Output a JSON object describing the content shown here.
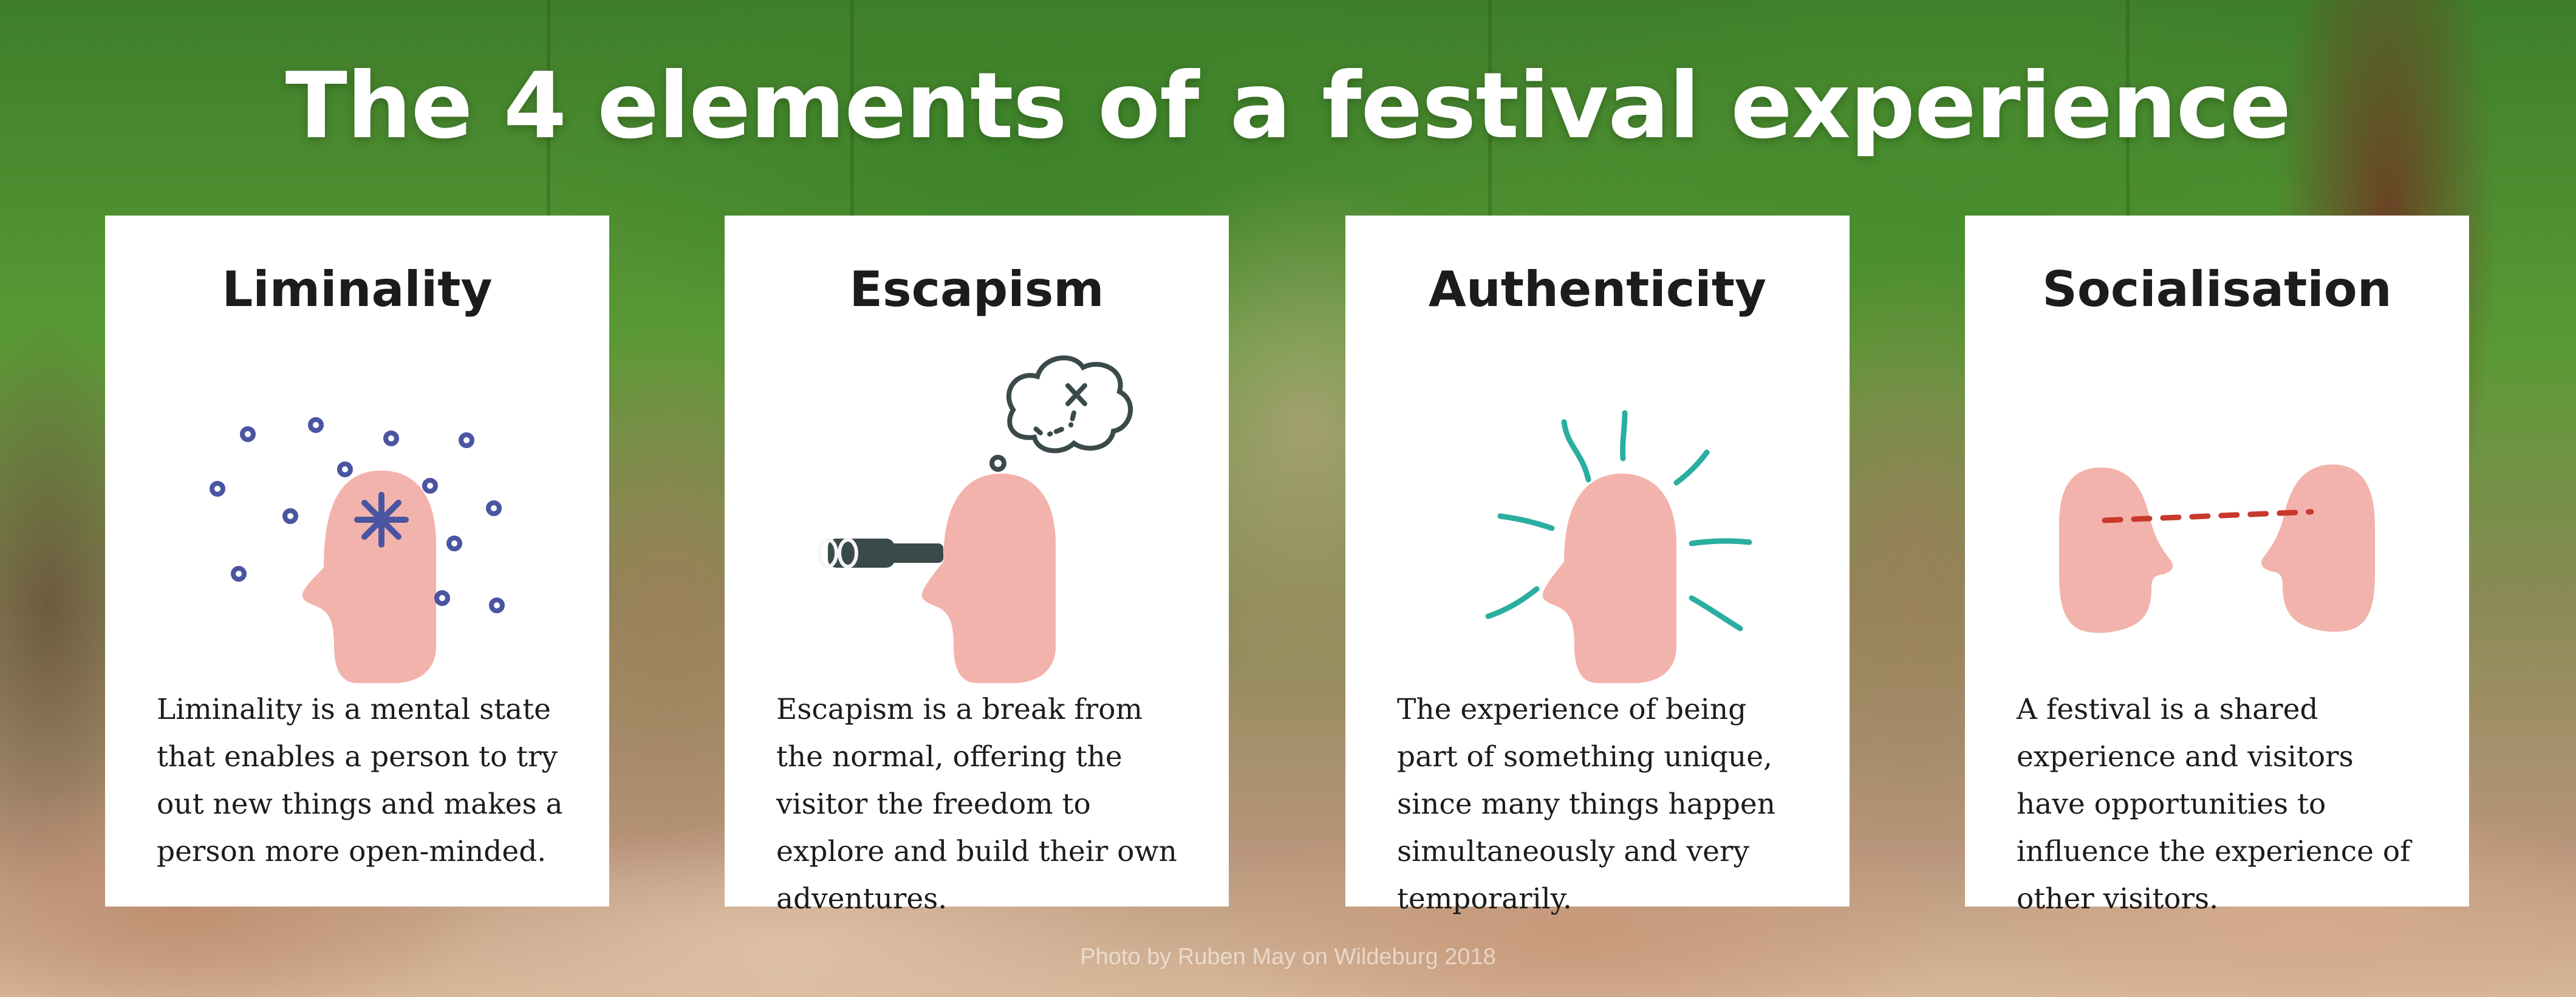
{
  "title": "The 4 elements of a festival experience",
  "cards": [
    {
      "heading": "Liminality",
      "icon": "head-with-asterisk-and-dots-icon",
      "text": "Liminality is a mental state that enables a person to try out new things and makes a person more open-minded."
    },
    {
      "heading": "Escapism",
      "icon": "head-with-binoculars-and-treasure-map-thought-icon",
      "text": "Escapism is a break from the normal, offering the visitor the freedom to explore and build their own adventures."
    },
    {
      "heading": "Authenticity",
      "icon": "head-with-radiating-lines-icon",
      "text": "The experience of being part of something unique, since many things happen simultaneously and very temporarily."
    },
    {
      "heading": "Socialisation",
      "icon": "two-heads-connected-icon",
      "text": "A festival is a shared experience and visitors have opportunities to influence the experience of other visitors."
    }
  ],
  "credit": "Photo by Ruben May on Wildeburg 2018",
  "colors": {
    "head": "#f2b3ac",
    "liminality_accent": "#4a55a2",
    "escapism_accent": "#3a4a4a",
    "authenticity_accent": "#2aaea0",
    "socialisation_accent": "#c9382c"
  }
}
